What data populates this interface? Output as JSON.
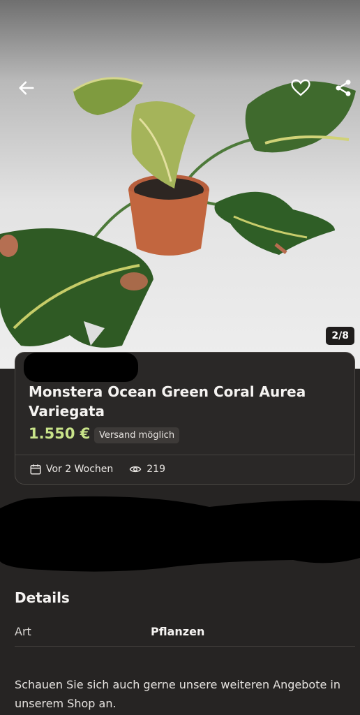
{
  "gallery": {
    "counter": "2/8"
  },
  "listing": {
    "title": "Monstera Ocean Green Coral Aurea Variegata",
    "price": "1.550 €",
    "shipping_badge": "Versand möglich",
    "posted": "Vor 2 Wochen",
    "views": "219"
  },
  "details": {
    "heading": "Details",
    "rows": [
      {
        "label": "Art",
        "value": "Pflanzen"
      }
    ],
    "description": "Schauen Sie sich auch gerne unsere weiteren Angebote in unserem Shop an."
  },
  "icons": {
    "back": "arrow-left-icon",
    "favorite": "heart-icon",
    "share": "share-icon",
    "calendar": "calendar-icon",
    "views": "eye-icon"
  },
  "colors": {
    "background": "#262423",
    "card": "#2a2827",
    "price": "#c9e48a"
  }
}
